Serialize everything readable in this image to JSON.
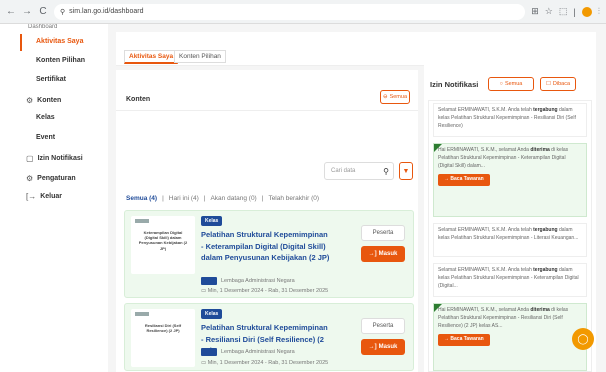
{
  "browser": {
    "url": "sim.lan.go.id/dashboard",
    "back_glyph": "←",
    "forward_glyph": "→",
    "reload_glyph": "C",
    "site_info_glyph": "⚲",
    "right_icons": [
      "⊞",
      "☆",
      "⬚",
      "|",
      "⫶"
    ]
  },
  "sidebar": {
    "top_cut_text": "Dashboard",
    "items": [
      {
        "label": "Aktivitas Saya",
        "icon": "",
        "active": true
      },
      {
        "label": "Konten Pilihan",
        "icon": ""
      },
      {
        "label": "Sertifikat",
        "icon": ""
      },
      {
        "label": "Konten",
        "icon": "⚙"
      },
      {
        "label": "Kelas",
        "icon": ""
      },
      {
        "label": "Event",
        "icon": ""
      },
      {
        "label": "Izin Notifikasi",
        "icon": "▢"
      },
      {
        "label": "Pengaturan",
        "icon": "⚙"
      },
      {
        "label": "Keluar",
        "icon": "[→"
      }
    ]
  },
  "tabs": [
    {
      "label": "Aktivitas Saya"
    },
    {
      "label": "Konten Pilihan"
    }
  ],
  "konten": {
    "title": "Konten",
    "semua_label": "Semua",
    "search_placeholder": "Cari data",
    "filters": [
      "Semua (4)",
      "Hari ini (4)",
      "Akan datang (0)",
      "Telah berakhir (0)"
    ]
  },
  "courses": [
    {
      "badge": "Kelas",
      "title": "Pelatihan Struktural Kepemimpinan - Keterampilan Digital (Digital Skill) dalam Penyusunan Kebijakan (2 JP)",
      "org": "Lembaga Administrasi Negara",
      "date": "Min, 1 Desember 2024 - Rab, 31 Desember 2025",
      "role": "Peserta",
      "action": "Masuk",
      "thumb_text": "Keterampilan Digital (Digital Skill) dalam Penyusunan Kebijakan (2 JP)",
      "org_logo": "LAN"
    },
    {
      "badge": "Kelas",
      "title": "Pelatihan Struktural Kepemimpinan - Resiliansi Diri (Self Resilience) (2 JP)",
      "org": "Lembaga Administrasi Negara",
      "date": "Min, 1 Desember 2024 - Rab, 31 Desember 2025",
      "role": "Peserta",
      "action": "Masuk",
      "thumb_text": "Resiliansi Diri (Self Resilience) (2 JP)",
      "org_logo": "LAN"
    }
  ],
  "notif": {
    "title": "Izin Notifikasi",
    "tab_all": "Semua",
    "tab_read": "Dibaca",
    "items": [
      {
        "pre": "Selamat ERMINAWATI, S.K.M. Anda telah ",
        "bold": "tergabung",
        "post": " dalam kelas Pelatihan Struktural Kepemimpinan - Resiliansi Diri (Self Resilience)",
        "style": "white"
      },
      {
        "pre": "Hai ERMINAWATI, S.K.M., selamat Anda ",
        "bold": "diterima",
        "post": " di kelas Pelatihan Struktural Kepemimpinan - Keterampilan Digital (Digital Skill) dalam...",
        "style": "green",
        "button": "Baca Tawaran"
      },
      {
        "pre": "Selamat ERMINAWATI, S.K.M. Anda telah ",
        "bold": "tergabung",
        "post": " dalam kelas Pelatihan Struktural Kepemimpinan - Literasi Keuangan...",
        "style": "white"
      },
      {
        "pre": "Selamat ERMINAWATI, S.K.M. Anda telah ",
        "bold": "tergabung",
        "post": " dalam kelas Pelatihan Struktural Kepemimpinan - Keterampilan Digital (Digital...",
        "style": "white"
      },
      {
        "pre": "Hai ERMINAWATI, S.K.M., selamat Anda ",
        "bold": "diterima",
        "post": " di kelas Pelatihan Struktural Kepemimpinan - Resiliansi Diri (Self Resilience) (2 JP) kelas AS...",
        "style": "green",
        "button": "Baca Tawaran"
      }
    ]
  },
  "chat_glyph": "◯",
  "colors": {
    "accent": "#e8570e",
    "primary": "#1f4b99",
    "green_bg": "#eef9ee"
  }
}
